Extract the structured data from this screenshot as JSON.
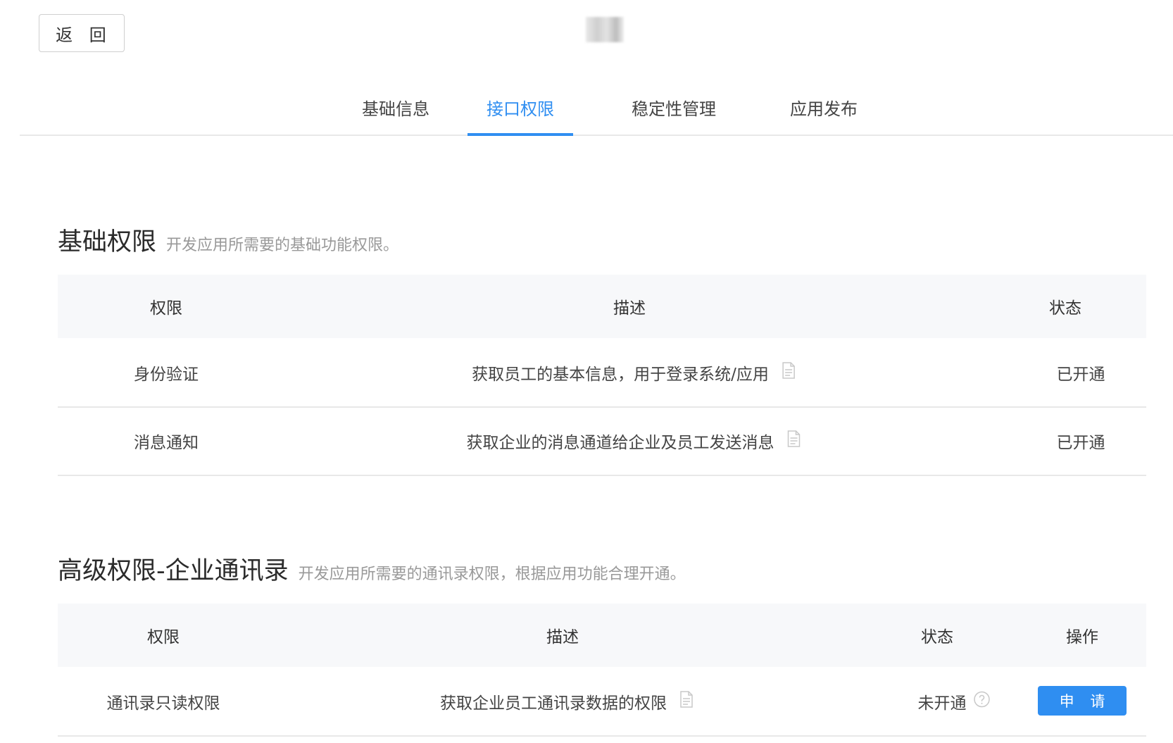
{
  "header": {
    "back_label": "返 回"
  },
  "tabs": [
    {
      "label": "基础信息",
      "active": false
    },
    {
      "label": "接口权限",
      "active": true
    },
    {
      "label": "稳定性管理",
      "active": false
    },
    {
      "label": "应用发布",
      "active": false
    }
  ],
  "colors": {
    "accent": "#2f8ef1",
    "header_bg": "#f7f8fa",
    "muted_text": "#999999"
  },
  "basic": {
    "title": "基础权限",
    "subtitle": "开发应用所需要的基础功能权限。",
    "columns": [
      "权限",
      "描述",
      "状态"
    ],
    "rows": [
      {
        "name": "身份验证",
        "desc": "获取员工的基本信息，用于登录系统/应用",
        "status": "已开通",
        "icon": "document-icon"
      },
      {
        "name": "消息通知",
        "desc": "获取企业的消息通道给企业及员工发送消息",
        "status": "已开通",
        "icon": "document-icon"
      }
    ]
  },
  "advanced": {
    "title": "高级权限-企业通讯录",
    "subtitle": "开发应用所需要的通讯录权限，根据应用功能合理开通。",
    "columns": [
      "权限",
      "描述",
      "状态",
      "操作"
    ],
    "rows": [
      {
        "name": "通讯录只读权限",
        "desc": "获取企业员工通讯录数据的权限",
        "status": "未开通",
        "action": "申 请",
        "icon": "document-icon",
        "status_icon": "help-icon"
      }
    ]
  }
}
